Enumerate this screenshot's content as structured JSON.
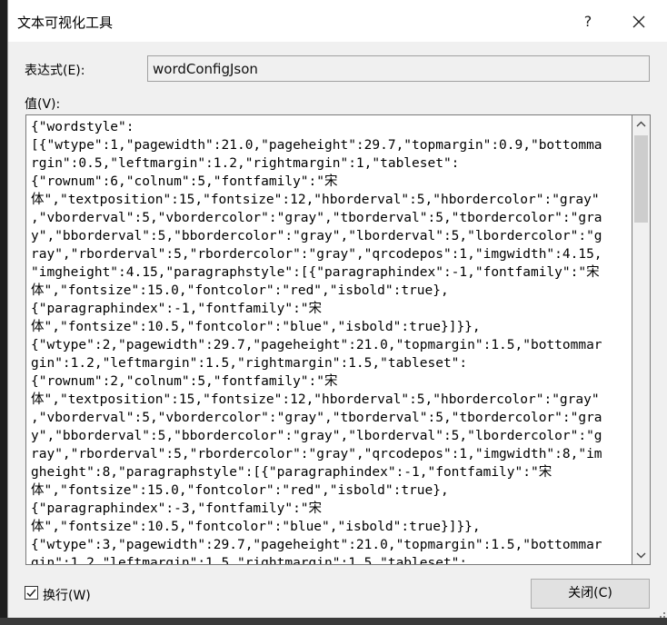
{
  "window": {
    "title": "文本可视化工具"
  },
  "titlebar": {
    "help": "?"
  },
  "expression": {
    "label": "表达式(E):",
    "value": "wordConfigJson"
  },
  "value": {
    "label": "值(V):",
    "text": "{\"wordstyle\":\n[{\"wtype\":1,\"pagewidth\":21.0,\"pageheight\":29.7,\"topmargin\":0.9,\"bottomma\nrgin\":0.5,\"leftmargin\":1.2,\"rightmargin\":1,\"tableset\":\n{\"rownum\":6,\"colnum\":5,\"fontfamily\":\"宋\n体\",\"textposition\":15,\"fontsize\":12,\"hborderval\":5,\"hbordercolor\":\"gray\"\n,\"vborderval\":5,\"vbordercolor\":\"gray\",\"tborderval\":5,\"tbordercolor\":\"gra\ny\",\"bborderval\":5,\"bbordercolor\":\"gray\",\"lborderval\":5,\"lbordercolor\":\"g\nray\",\"rborderval\":5,\"rbordercolor\":\"gray\",\"qrcodepos\":1,\"imgwidth\":4.15,\n\"imgheight\":4.15,\"paragraphstyle\":[{\"paragraphindex\":-1,\"fontfamily\":\"宋\n体\",\"fontsize\":15.0,\"fontcolor\":\"red\",\"isbold\":true},\n{\"paragraphindex\":-1,\"fontfamily\":\"宋\n体\",\"fontsize\":10.5,\"fontcolor\":\"blue\",\"isbold\":true}]}},\n{\"wtype\":2,\"pagewidth\":29.7,\"pageheight\":21.0,\"topmargin\":1.5,\"bottommar\ngin\":1.2,\"leftmargin\":1.5,\"rightmargin\":1.5,\"tableset\":\n{\"rownum\":2,\"colnum\":5,\"fontfamily\":\"宋\n体\",\"textposition\":15,\"fontsize\":12,\"hborderval\":5,\"hbordercolor\":\"gray\"\n,\"vborderval\":5,\"vbordercolor\":\"gray\",\"tborderval\":5,\"tbordercolor\":\"gra\ny\",\"bborderval\":5,\"bbordercolor\":\"gray\",\"lborderval\":5,\"lbordercolor\":\"g\nray\",\"rborderval\":5,\"rbordercolor\":\"gray\",\"qrcodepos\":1,\"imgwidth\":8,\"im\ngheight\":8,\"paragraphstyle\":[{\"paragraphindex\":-1,\"fontfamily\":\"宋\n体\",\"fontsize\":15.0,\"fontcolor\":\"red\",\"isbold\":true},\n{\"paragraphindex\":-3,\"fontfamily\":\"宋\n体\",\"fontsize\":10.5,\"fontcolor\":\"blue\",\"isbold\":true}]}},\n{\"wtype\":3,\"pagewidth\":29.7,\"pageheight\":21.0,\"topmargin\":1.5,\"bottommar\ngin\":1.2,\"leftmargin\":1.5,\"rightmargin\":1.5,\"tableset\":"
  },
  "wrap": {
    "label": "换行(W)",
    "checked": true
  },
  "buttons": {
    "close": "关闭(C)"
  },
  "icons": {
    "close": "close-icon",
    "up": "chevron-up-icon",
    "down": "chevron-down-icon",
    "check": "checkmark-icon"
  }
}
